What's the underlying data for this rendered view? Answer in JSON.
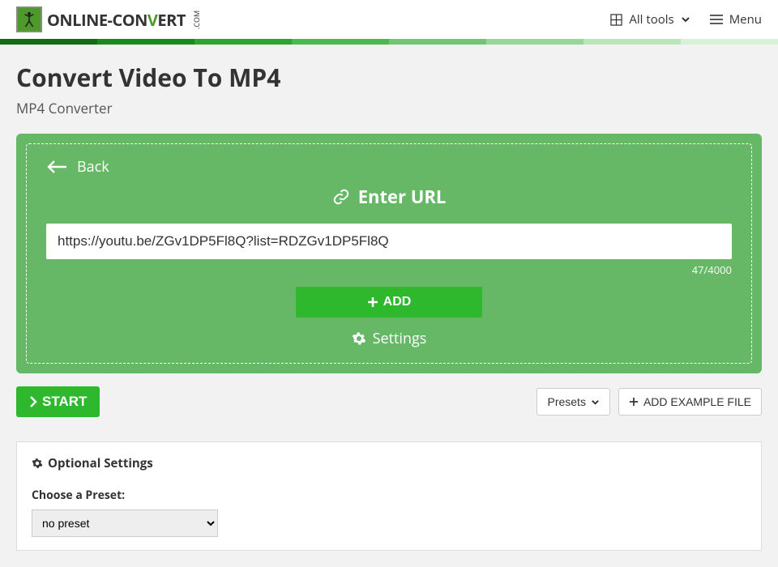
{
  "header": {
    "logo": {
      "t1": "ONLINE-",
      "t2": "CON",
      "t3": "V",
      "t4": "ERT",
      "sup": ".COM"
    },
    "all_tools": "All tools",
    "menu": "Menu"
  },
  "gradbar": [
    "#126e12",
    "#1a8a1a",
    "#2da52d",
    "#4bb94b",
    "#6fc86f",
    "#94d994",
    "#b9e7b9",
    "#d8f2d8"
  ],
  "page": {
    "title": "Convert Video To MP4",
    "subtitle": "MP4 Converter"
  },
  "panel": {
    "back": "Back",
    "enter_url": "Enter URL",
    "url_value": "https://youtu.be/ZGv1DP5Fl8Q?list=RDZGv1DP5Fl8Q",
    "count": "47/4000",
    "add": "ADD",
    "settings": "Settings"
  },
  "actions": {
    "start": "START",
    "presets": "Presets",
    "add_example": "ADD EXAMPLE FILE"
  },
  "opts": {
    "heading": "Optional Settings",
    "preset_label": "Choose a Preset:",
    "preset_value": "no preset"
  }
}
